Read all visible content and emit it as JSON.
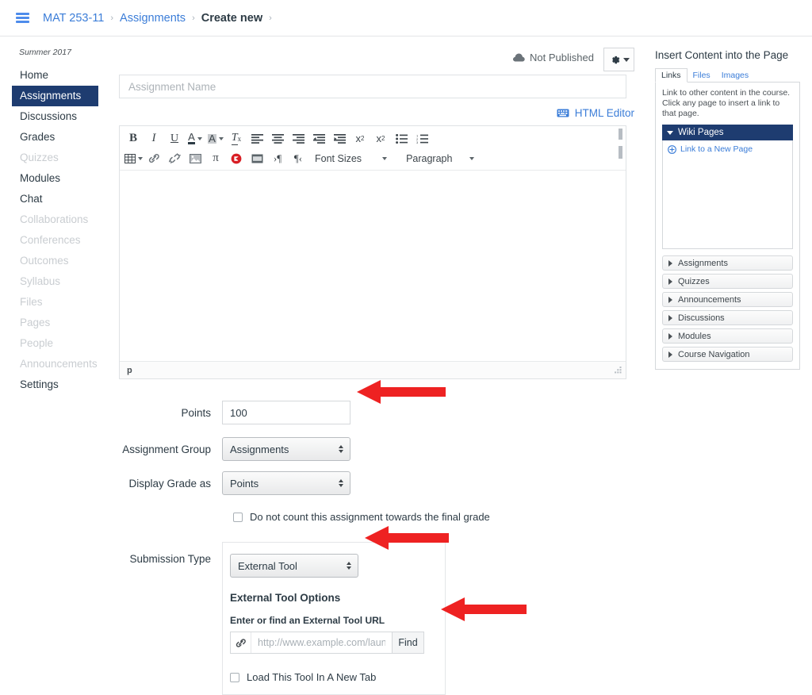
{
  "breadcrumb": {
    "menu_icon": "hamburger-icon",
    "items": [
      {
        "label": "MAT 253-11",
        "current": false
      },
      {
        "label": "Assignments",
        "current": false
      },
      {
        "label": "Create new",
        "current": true
      }
    ],
    "separator": "›"
  },
  "course_nav": {
    "term": "Summer 2017",
    "items": [
      {
        "label": "Home",
        "state": "normal"
      },
      {
        "label": "Assignments",
        "state": "active"
      },
      {
        "label": "Discussions",
        "state": "normal"
      },
      {
        "label": "Grades",
        "state": "normal"
      },
      {
        "label": "Quizzes",
        "state": "disabled"
      },
      {
        "label": "Modules",
        "state": "normal"
      },
      {
        "label": "Chat",
        "state": "normal"
      },
      {
        "label": "Collaborations",
        "state": "disabled"
      },
      {
        "label": "Conferences",
        "state": "disabled"
      },
      {
        "label": "Outcomes",
        "state": "disabled"
      },
      {
        "label": "Syllabus",
        "state": "disabled"
      },
      {
        "label": "Files",
        "state": "disabled"
      },
      {
        "label": "Pages",
        "state": "disabled"
      },
      {
        "label": "People",
        "state": "disabled"
      },
      {
        "label": "Announcements",
        "state": "disabled"
      },
      {
        "label": "Settings",
        "state": "normal"
      }
    ]
  },
  "header": {
    "publish_status": "Not Published",
    "publish_icon": "cloud-icon",
    "gear_icon": "gear-icon",
    "gear_caret": "chevron-down-icon"
  },
  "assignment_name": {
    "value": "",
    "placeholder": "Assignment Name"
  },
  "editor": {
    "html_editor_label": "HTML Editor",
    "html_editor_icon": "keyboard-icon",
    "toolbar_row1": [
      {
        "icon": "bold-icon",
        "glyph": "B"
      },
      {
        "icon": "italic-icon",
        "glyph": "I"
      },
      {
        "icon": "underline-icon",
        "glyph": "U"
      },
      {
        "icon": "text-color-icon",
        "glyph": "A"
      },
      {
        "icon": "background-color-icon",
        "glyph": "A"
      },
      {
        "icon": "clear-formatting-icon",
        "glyph": "Tx"
      },
      {
        "icon": "align-left-icon",
        "glyph": ""
      },
      {
        "icon": "align-center-icon",
        "glyph": ""
      },
      {
        "icon": "align-right-icon",
        "glyph": ""
      },
      {
        "icon": "outdent-icon",
        "glyph": ""
      },
      {
        "icon": "indent-icon",
        "glyph": ""
      },
      {
        "icon": "superscript-icon",
        "glyph": "x²"
      },
      {
        "icon": "subscript-icon",
        "glyph": "x₂"
      },
      {
        "icon": "bulleted-list-icon",
        "glyph": ""
      },
      {
        "icon": "numbered-list-icon",
        "glyph": ""
      }
    ],
    "toolbar_row2": [
      {
        "icon": "table-icon"
      },
      {
        "icon": "link-icon"
      },
      {
        "icon": "unlink-icon"
      },
      {
        "icon": "image-icon"
      },
      {
        "icon": "math-equation-icon"
      },
      {
        "icon": "record-media-icon"
      },
      {
        "icon": "embed-media-icon"
      },
      {
        "icon": "rtl-paragraph-icon"
      },
      {
        "icon": "ltr-paragraph-icon"
      }
    ],
    "font_sizes_label": "Font Sizes",
    "paragraph_label": "Paragraph",
    "content": "",
    "status_path": "p",
    "resize_handle": "resize-grip-icon"
  },
  "form": {
    "points": {
      "label": "Points",
      "value": "100"
    },
    "assignment_group": {
      "label": "Assignment Group",
      "value": "Assignments"
    },
    "display_grade_as": {
      "label": "Display Grade as",
      "value": "Points"
    },
    "omit_from_final_grade": {
      "label": "Do not count this assignment towards the final grade",
      "checked": false
    },
    "submission_type": {
      "label": "Submission Type",
      "value": "External Tool"
    },
    "external_tool": {
      "heading": "External Tool Options",
      "url_label": "Enter or find an External Tool URL",
      "url_value": "",
      "url_placeholder": "http://www.example.com/launch",
      "url_icon": "link-icon",
      "find_button": "Find",
      "new_tab": {
        "label": "Load This Tool In A New Tab",
        "checked": false
      }
    }
  },
  "insert_panel": {
    "title": "Insert Content into the Page",
    "tabs": [
      {
        "label": "Links",
        "active": true
      },
      {
        "label": "Files",
        "active": false
      },
      {
        "label": "Images",
        "active": false
      }
    ],
    "description": "Link to other content in the course. Click any page to insert a link to that page.",
    "wiki_pages": {
      "label": "Wiki Pages",
      "expanded": true,
      "new_page_link": "Link to a New Page",
      "new_page_icon": "plus-circle-icon"
    },
    "sections": [
      {
        "label": "Assignments"
      },
      {
        "label": "Quizzes"
      },
      {
        "label": "Announcements"
      },
      {
        "label": "Discussions"
      },
      {
        "label": "Modules"
      },
      {
        "label": "Course Navigation"
      }
    ]
  },
  "annotations": {
    "arrow_color": "#ee2222",
    "arrows": [
      {
        "name": "points-arrow",
        "target": "points-input"
      },
      {
        "name": "submission-type-arrow",
        "target": "submission-type-select"
      },
      {
        "name": "find-button-arrow",
        "target": "find-button"
      }
    ]
  }
}
